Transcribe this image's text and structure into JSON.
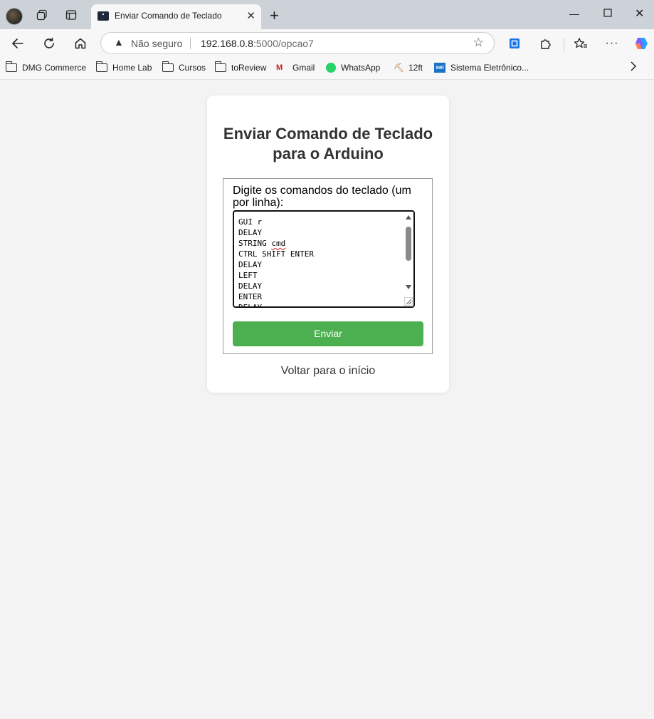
{
  "browser": {
    "tab": {
      "title": "Enviar Comando de Teclado"
    },
    "address": {
      "security_label": "Não seguro",
      "url_host": "192.168.0.8",
      "url_path": ":5000/opcao7"
    },
    "bookmarks": [
      {
        "label": "DMG Commerce",
        "icon": "folder-icon"
      },
      {
        "label": "Home Lab",
        "icon": "folder-icon"
      },
      {
        "label": "Cursos",
        "icon": "folder-icon"
      },
      {
        "label": "toReview",
        "icon": "folder-icon"
      },
      {
        "label": "Gmail",
        "icon": "gmail-icon"
      },
      {
        "label": "WhatsApp",
        "icon": "whatsapp-icon"
      },
      {
        "label": "12ft",
        "icon": "12ft-icon"
      },
      {
        "label": "Sistema Eletrônico...",
        "icon": "sei-icon"
      }
    ]
  },
  "page": {
    "heading": "Enviar Comando de Teclado para o Arduino",
    "form": {
      "label": "Digite os comandos do teclado (um por linha):",
      "textarea_lines": [
        "GUI r",
        "DELAY",
        "STRING cmd",
        "CTRL SHIFT ENTER",
        "DELAY",
        "LEFT",
        "DELAY",
        "ENTER",
        "DELAY"
      ],
      "submit_label": "Enviar"
    },
    "back_link": "Voltar para o início"
  },
  "colors": {
    "accent_button": "#4caf50",
    "page_background": "#f3f3f3",
    "card_background": "#ffffff"
  }
}
